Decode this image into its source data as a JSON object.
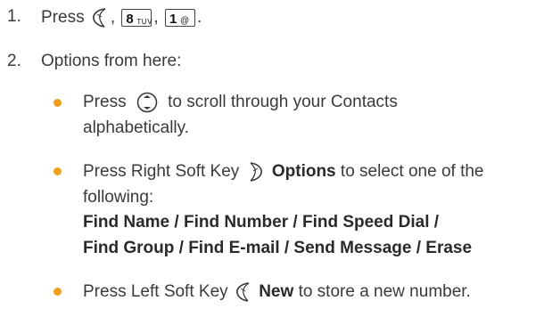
{
  "steps": [
    {
      "number": "1.",
      "text": "Press",
      "sep1": ",",
      "sep2": ",",
      "end": ".",
      "keys": [
        {
          "main": "8",
          "sub": "TUV"
        },
        {
          "main": "1",
          "sub": "@"
        }
      ]
    },
    {
      "number": "2.",
      "text": "Options from here:"
    }
  ],
  "bullets": [
    {
      "pre": "Press",
      "post": "to scroll through your Contacts",
      "line2": "alphabetically."
    },
    {
      "pre": "Press Right Soft Key",
      "bold": "Options",
      "post": "to select one of the",
      "line2": "following:",
      "menu_line1": "Find Name / Find Number / Find Speed Dial /",
      "menu_line2": "Find Group / Find E-mail / Send Message / Erase"
    },
    {
      "pre": "Press Left Soft Key",
      "bold": "New",
      "post": "to store a new number."
    }
  ],
  "colors": {
    "bullet": "#f0a020",
    "text": "#3a3a3a"
  },
  "icons": [
    "left-soft-key-icon",
    "navigation-key-icon",
    "right-soft-key-icon"
  ]
}
